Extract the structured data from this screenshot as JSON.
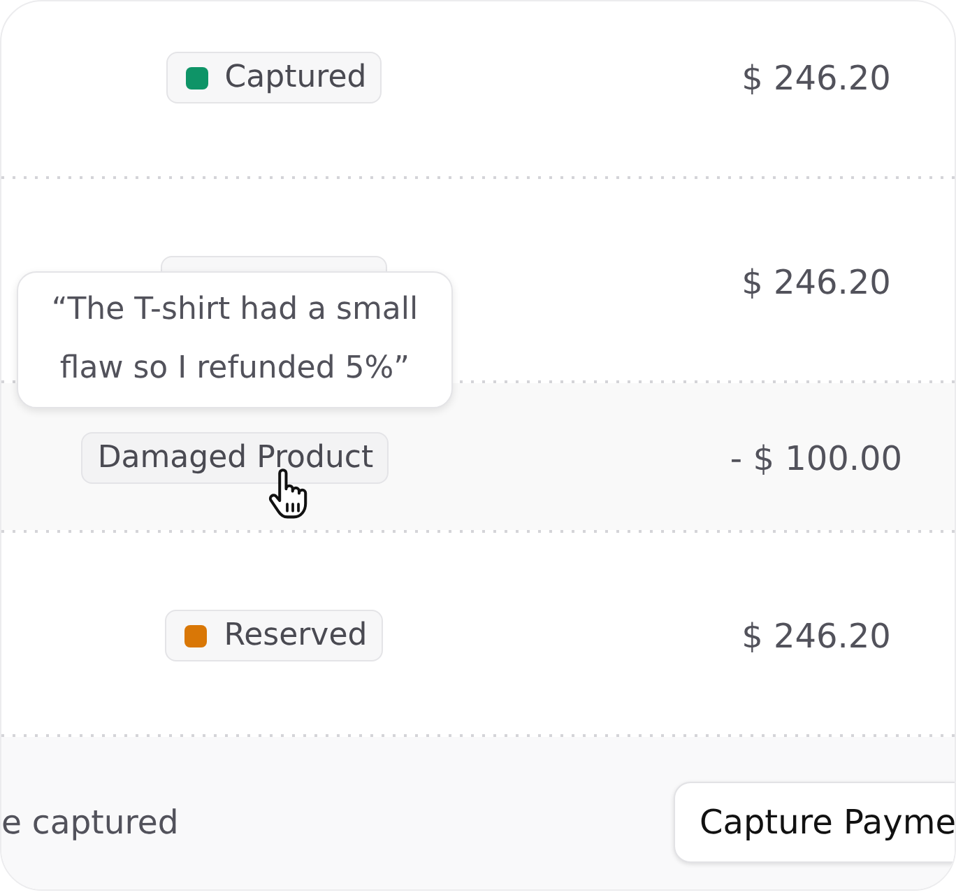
{
  "rows": [
    {
      "kind": "status",
      "badge": {
        "label": "Captured",
        "color": "#0e9467"
      },
      "amount": "$ 246.20"
    },
    {
      "kind": "status",
      "badge": {},
      "amount": "$ 246.20"
    },
    {
      "kind": "reason",
      "badge": {
        "label": "Damaged Product"
      },
      "tooltip": "“The T-shirt had a small flaw so I refunded 5%”",
      "amount": "- $ 100.00"
    },
    {
      "kind": "status",
      "badge": {
        "label": "Reserved",
        "color": "#d97706"
      },
      "amount": "$ 246.20"
    }
  ],
  "footer": {
    "note": "e captured",
    "button": "Capture Payme"
  }
}
